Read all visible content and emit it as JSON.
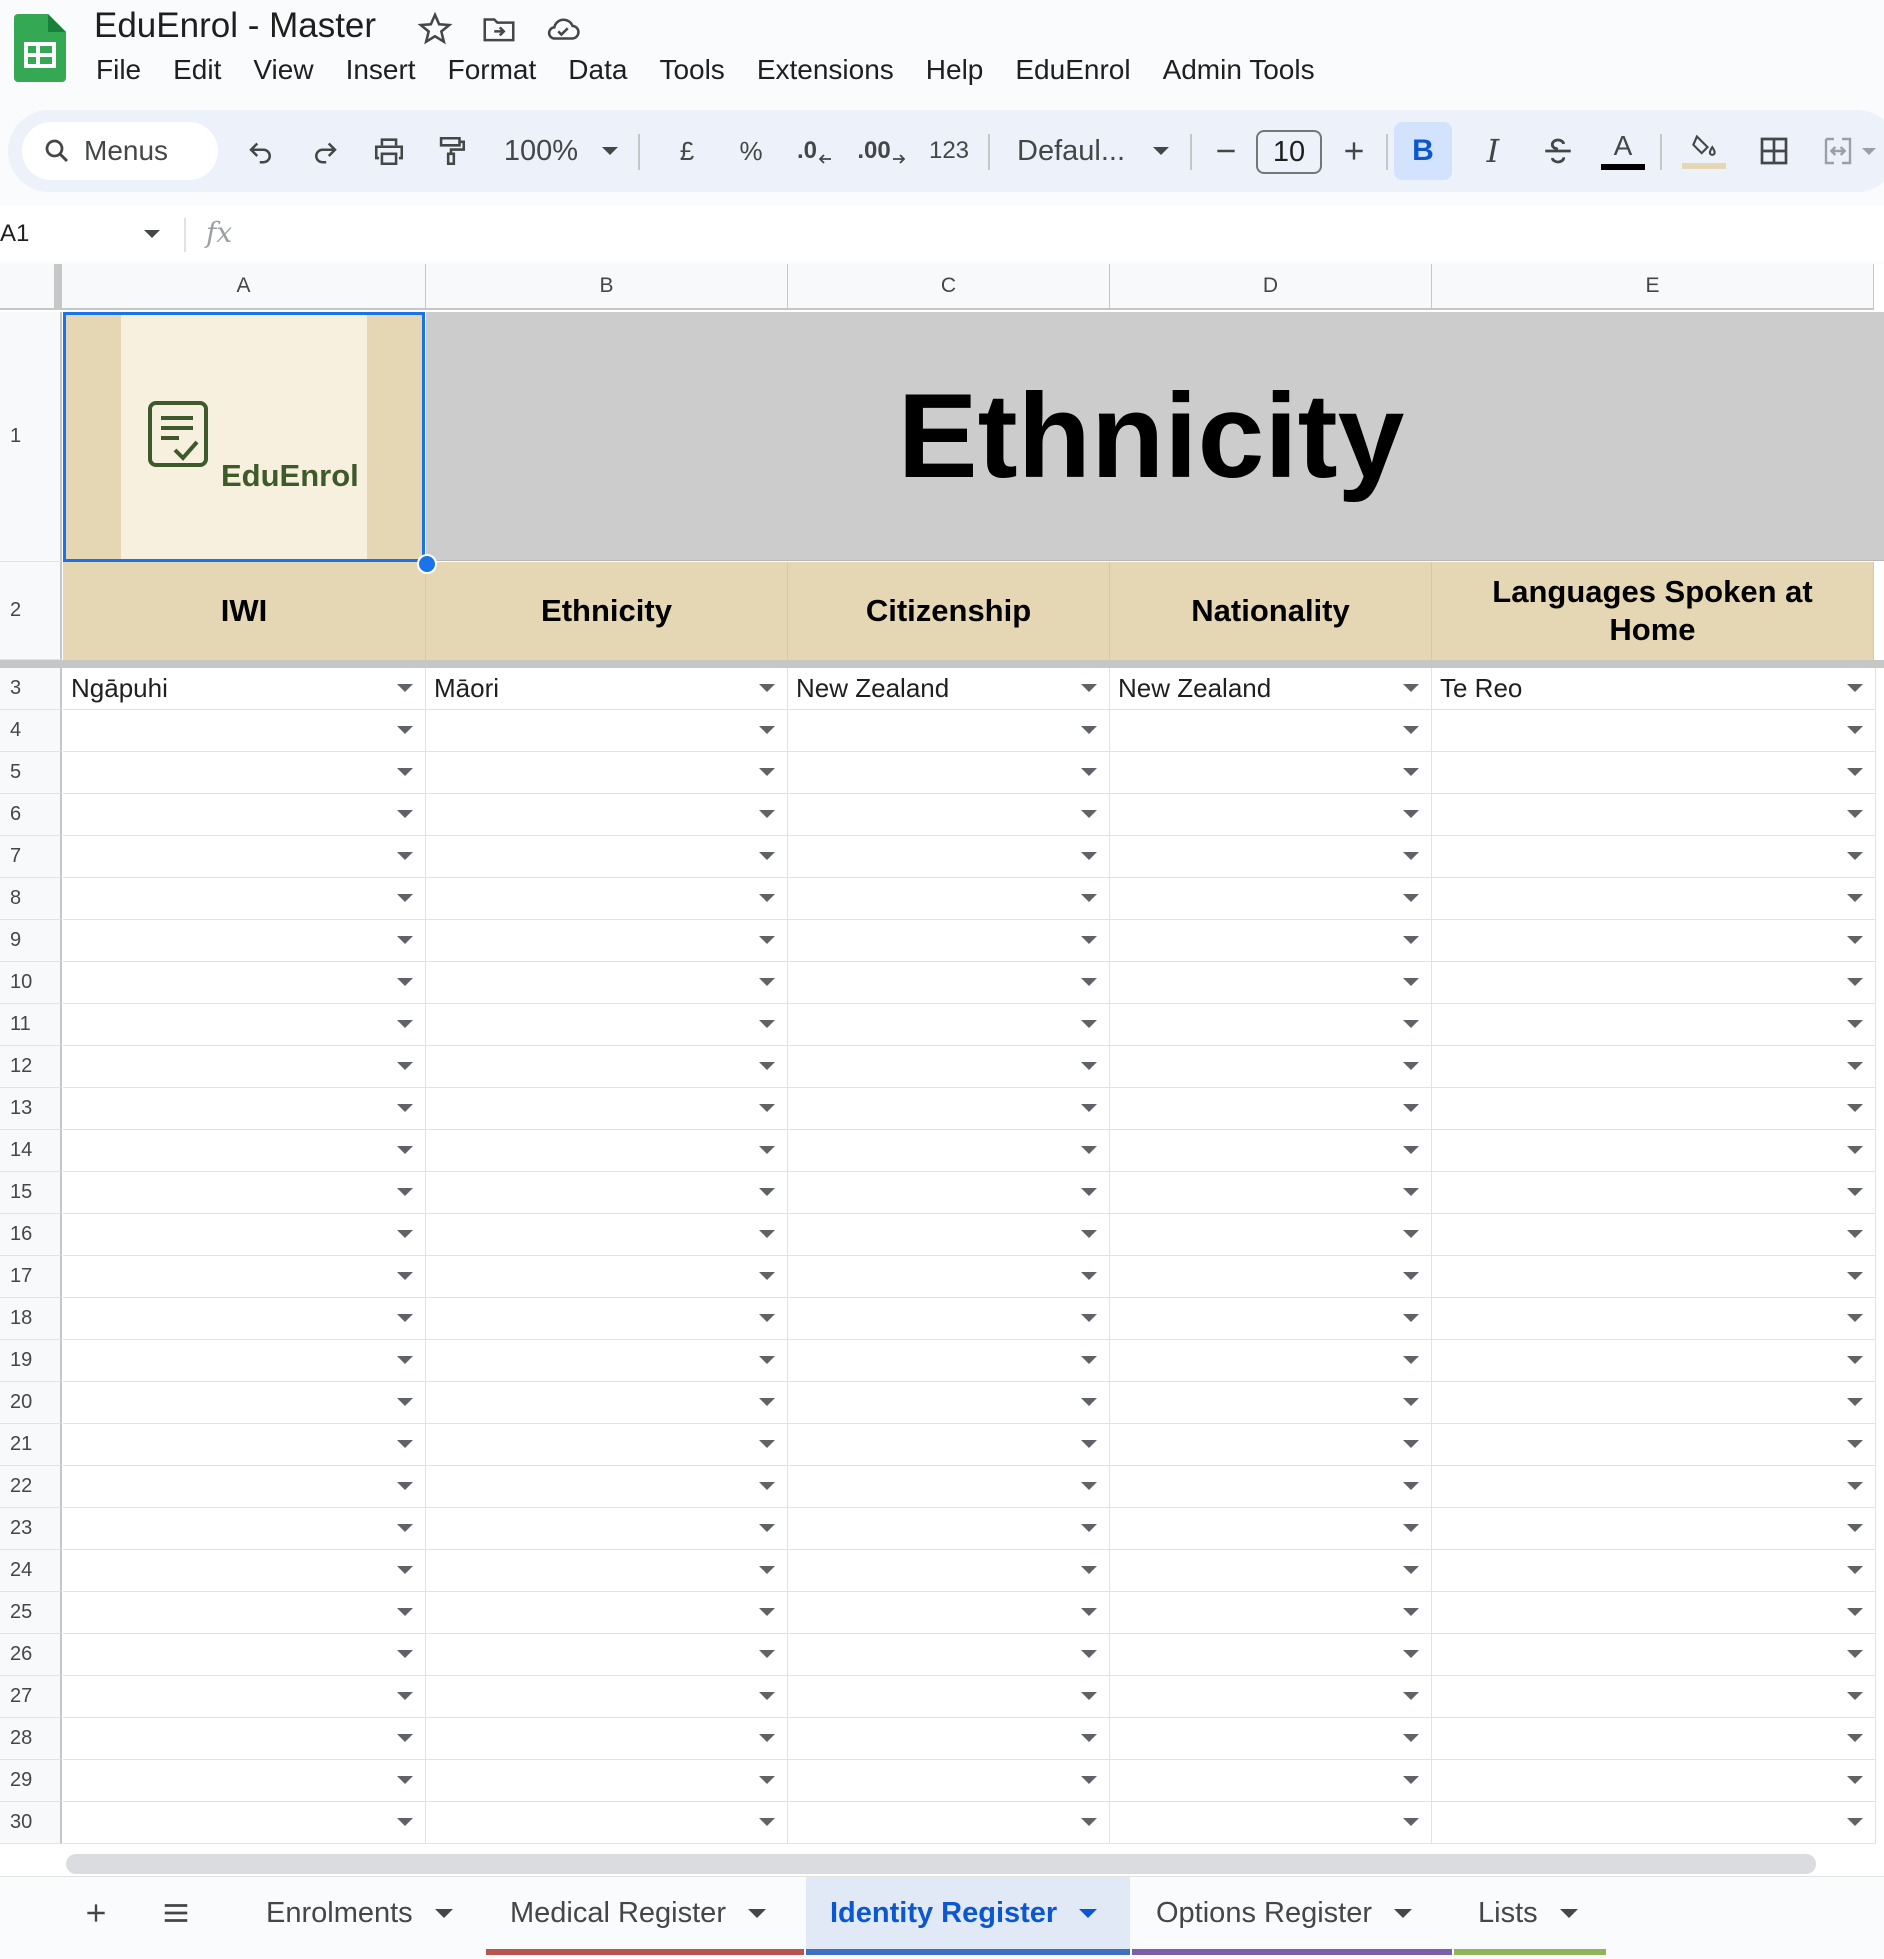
{
  "app": {
    "title": "EduEnrol - Master",
    "menus": [
      "File",
      "Edit",
      "View",
      "Insert",
      "Format",
      "Data",
      "Tools",
      "Extensions",
      "Help",
      "EduEnrol",
      "Admin Tools"
    ]
  },
  "toolbar": {
    "search_label": "Menus",
    "zoom": "100%",
    "currency": "£",
    "percent": "%",
    "decrease_decimal": ".0",
    "increase_decimal": ".00",
    "number_format": "123",
    "font": "Defaul...",
    "font_size": "10",
    "bold": "B",
    "italic": "I",
    "text_color_label": "A"
  },
  "formula_bar": {
    "cell_ref": "A1",
    "fx": "fx",
    "content": ""
  },
  "columns": [
    "A",
    "B",
    "C",
    "D",
    "E"
  ],
  "row_numbers": [
    "1",
    "2",
    "3",
    "4",
    "5",
    "6",
    "7",
    "8",
    "9",
    "10",
    "11",
    "12",
    "13",
    "14",
    "15",
    "16",
    "17",
    "18",
    "19",
    "20",
    "21",
    "22",
    "23",
    "24",
    "25",
    "26",
    "27",
    "28",
    "29",
    "30"
  ],
  "banner": {
    "logo_text": "EduEnrol",
    "title": "Ethnicity"
  },
  "headers": [
    "IWI",
    "Ethnicity",
    "Citizenship",
    "Nationality",
    "Languages Spoken at Home"
  ],
  "rows": [
    [
      "Ngāpuhi",
      "Māori",
      "New Zealand",
      "New Zealand",
      "Te Reo"
    ]
  ],
  "sheet_tabs": [
    {
      "label": "Enrolments",
      "color": ""
    },
    {
      "label": "Medical Register",
      "color": "#b85450"
    },
    {
      "label": "Identity Register",
      "color": "#3f6fbf",
      "active": true
    },
    {
      "label": "Options Register",
      "color": "#7b5fa8"
    },
    {
      "label": "Lists",
      "color": "#8fb55b"
    }
  ],
  "colors": {
    "selection": "#1a73e8",
    "header_fill": "#e6d7b4",
    "banner_fill": "#cccccc"
  }
}
